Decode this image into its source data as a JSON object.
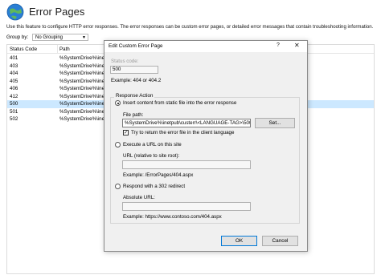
{
  "page": {
    "title": "Error Pages",
    "description": "Use this feature to configure HTTP error responses. The error responses can be custom error pages, or detailed error messages that contain troubleshooting information."
  },
  "toolbar": {
    "group_by_label": "Group by:",
    "group_by_value": "No Grouping"
  },
  "grid": {
    "columns": [
      "Status Code",
      "Path"
    ],
    "rows": [
      {
        "code": "401",
        "path": "%SystemDrive%\\inetp"
      },
      {
        "code": "403",
        "path": "%SystemDrive%\\inetp"
      },
      {
        "code": "404",
        "path": "%SystemDrive%\\inetp"
      },
      {
        "code": "405",
        "path": "%SystemDrive%\\inetp"
      },
      {
        "code": "406",
        "path": "%SystemDrive%\\inetp"
      },
      {
        "code": "412",
        "path": "%SystemDrive%\\inetp"
      },
      {
        "code": "500",
        "path": "%SystemDrive%\\inetp"
      },
      {
        "code": "501",
        "path": "%SystemDrive%\\inetp"
      },
      {
        "code": "502",
        "path": "%SystemDrive%\\inetp"
      }
    ],
    "selected_code": "500"
  },
  "dialog": {
    "title": "Edit Custom Error Page",
    "help_label": "?",
    "close_label": "✕",
    "status_code_label": "Status code:",
    "status_code_value": "500",
    "status_example": "Example: 404 or 404.2",
    "response_action_label": "Response Action",
    "option_static": "Insert content from static file into the error response",
    "file_path_label": "File path:",
    "file_path_value": "%SystemDrive%\\inetpub\\custerr\\<LANGUAGE-TAG>\\500.htm",
    "set_button": "Set...",
    "try_return_label": "Try to return the error file in the client language",
    "option_url": "Execute a URL on this site",
    "url_label": "URL (relative to site root):",
    "url_value": "",
    "url_example": "Example: /ErrorPages/404.aspx",
    "option_redirect": "Respond with a 302 redirect",
    "absolute_url_label": "Absolute URL:",
    "absolute_url_value": "",
    "absolute_url_example": "Example: https://www.contoso.com/404.aspx",
    "ok_button": "OK",
    "cancel_button": "Cancel",
    "selected_option": "static",
    "try_return_checked": true
  }
}
